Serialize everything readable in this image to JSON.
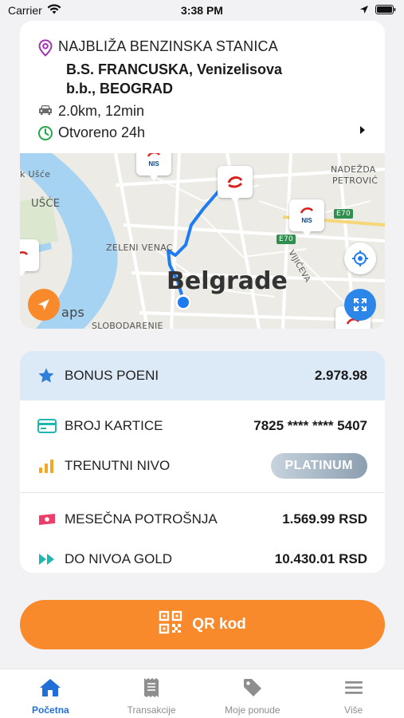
{
  "status_bar": {
    "carrier": "Carrier",
    "time": "3:38 PM"
  },
  "station": {
    "heading": "NAJBLIŽA BENZINSKA STANICA",
    "name": "B.S. FRANCUSKA, Venizelisova b.b., BEOGRAD",
    "distance": "2.0km, 12min",
    "hours": "Otvoreno 24h"
  },
  "map": {
    "city": "Belgrade",
    "labels": {
      "usce_small": "k Ušće",
      "usce": "UŠĆE",
      "zeleni_venac": "ZELENI VENAC",
      "nadezda": "NADEŽDA",
      "petrovic": "PETROVIĆ",
      "e70_a": "E70",
      "e70_b": "E70",
      "vijiceva": "VIJIĆEVA",
      "maps": "aps",
      "slobodarenje": "SLOBODARENJE"
    },
    "marker_text": "NIS"
  },
  "loyalty": {
    "bonus_label": "BONUS POENI",
    "bonus_value": "2.978.98",
    "card_label": "BROJ KARTICE",
    "card_value": "7825 **** **** 5407",
    "level_label": "TRENUTNI NIVO",
    "level_value": "PLATINUM",
    "spend_label": "MESEČNA POTROŠNJA",
    "spend_value": "1.569.99 RSD",
    "gold_label": "DO NIVOA GOLD",
    "gold_value": "10.430.01 RSD"
  },
  "qr_button": {
    "label": "QR kod"
  },
  "tabs": [
    {
      "label": "Početna",
      "icon": "home-icon",
      "active": true
    },
    {
      "label": "Transakcije",
      "icon": "receipt-icon",
      "active": false
    },
    {
      "label": "Moje ponude",
      "icon": "tag-icon",
      "active": false
    },
    {
      "label": "Više",
      "icon": "menu-icon",
      "active": false
    }
  ],
  "colors": {
    "accent": "#f98a2c",
    "active_tab": "#1f6fd6",
    "bonus_bg": "#dce9f6"
  }
}
